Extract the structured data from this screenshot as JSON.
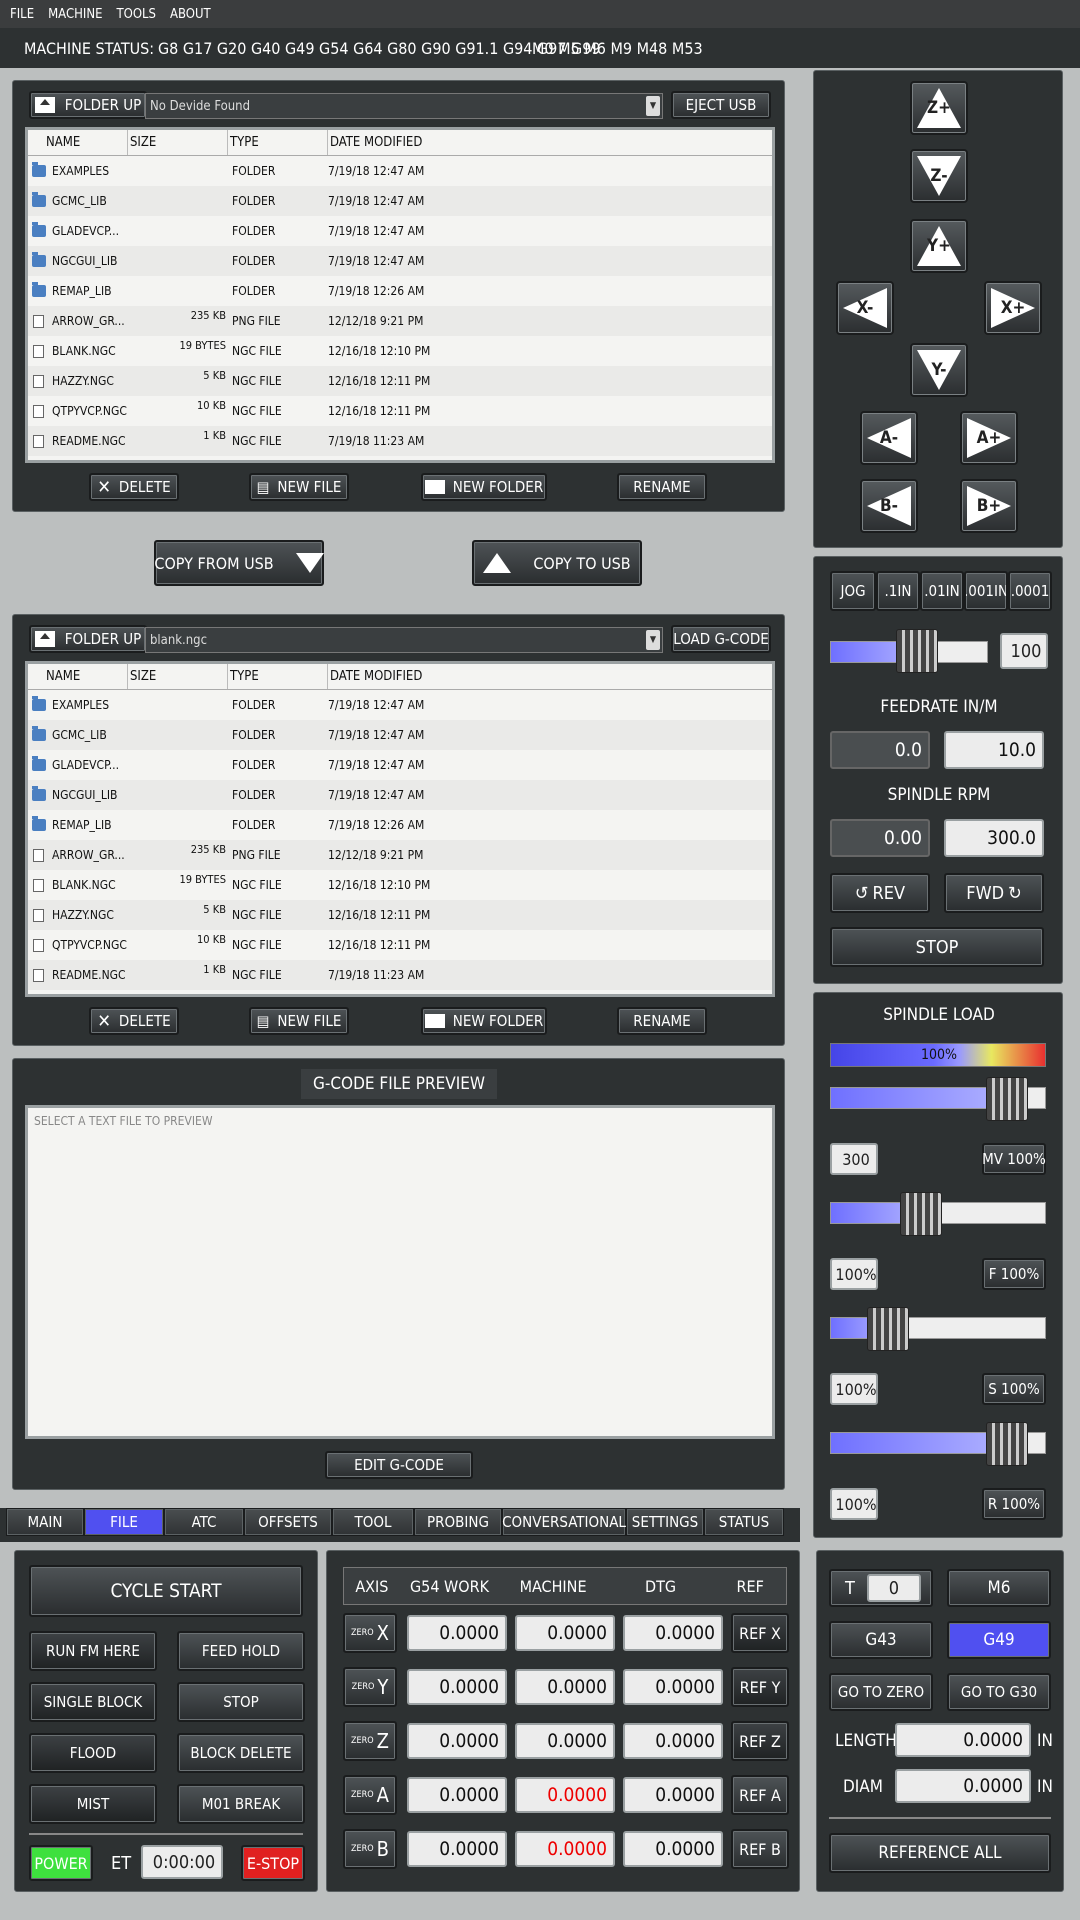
{
  "menu": [
    "FILE",
    "MACHINE",
    "TOOLS",
    "ABOUT"
  ],
  "status": {
    "label": "MACHINE STATUS:",
    "gcodes": "G8 G17 G20 G40 G49 G54 G64 G80 G90 G91.1 G94 G97 G99",
    "mcodes": "M0 M5 M6 M9 M48 M53"
  },
  "usb": {
    "folder_up": "FOLDER UP",
    "device": "No Devide Found",
    "eject": "EJECT USB",
    "cols": [
      "NAME",
      "SIZE",
      "TYPE",
      "DATE MODIFIED"
    ],
    "rows": [
      {
        "name": "EXAMPLES",
        "size": "",
        "type": "FOLDER",
        "date": "7/19/18 12:47 AM",
        "icon": "folder"
      },
      {
        "name": "GCMC_LIB",
        "size": "",
        "type": "FOLDER",
        "date": "7/19/18 12:47 AM",
        "icon": "folder"
      },
      {
        "name": "GLADEVCP...",
        "size": "",
        "type": "FOLDER",
        "date": "7/19/18 12:47 AM",
        "icon": "folder"
      },
      {
        "name": "NGCGUI_LIB",
        "size": "",
        "type": "FOLDER",
        "date": "7/19/18 12:47 AM",
        "icon": "folder"
      },
      {
        "name": "REMAP_LIB",
        "size": "",
        "type": "FOLDER",
        "date": "7/19/18 12:26 AM",
        "icon": "folder"
      },
      {
        "name": "ARROW_GR...",
        "size": "235 KB",
        "type": "PNG FILE",
        "date": "12/12/18 9:21 PM",
        "icon": "doc"
      },
      {
        "name": "BLANK.NGC",
        "size": "19 BYTES",
        "type": "NGC FILE",
        "date": "12/16/18 12:10 PM",
        "icon": "doc"
      },
      {
        "name": "HAZZY.NGC",
        "size": "5 KB",
        "type": "NGC FILE",
        "date": "12/16/18 12:11 PM",
        "icon": "doc"
      },
      {
        "name": "QTPYVCP.NGC",
        "size": "10 KB",
        "type": "NGC FILE",
        "date": "12/16/18 12:11 PM",
        "icon": "doc"
      },
      {
        "name": "README.NGC",
        "size": "1 KB",
        "type": "NGC FILE",
        "date": "7/19/18 11:23 AM",
        "icon": "doc"
      }
    ],
    "delete": "DELETE",
    "new_file": "NEW FILE",
    "new_folder": "NEW FOLDER",
    "rename": "RENAME"
  },
  "copy_from_usb": "COPY FROM USB",
  "copy_to_usb": "COPY TO USB",
  "local": {
    "folder_up": "FOLDER UP",
    "file": "blank.ngc",
    "load": "LOAD G-CODE",
    "cols": [
      "NAME",
      "SIZE",
      "TYPE",
      "DATE MODIFIED"
    ],
    "rows": [
      {
        "name": "EXAMPLES",
        "size": "",
        "type": "FOLDER",
        "date": "7/19/18 12:47 AM",
        "icon": "folder"
      },
      {
        "name": "GCMC_LIB",
        "size": "",
        "type": "FOLDER",
        "date": "7/19/18 12:47 AM",
        "icon": "folder"
      },
      {
        "name": "GLADEVCP...",
        "size": "",
        "type": "FOLDER",
        "date": "7/19/18 12:47 AM",
        "icon": "folder"
      },
      {
        "name": "NGCGUI_LIB",
        "size": "",
        "type": "FOLDER",
        "date": "7/19/18 12:47 AM",
        "icon": "folder"
      },
      {
        "name": "REMAP_LIB",
        "size": "",
        "type": "FOLDER",
        "date": "7/19/18 12:26 AM",
        "icon": "folder"
      },
      {
        "name": "ARROW_GR...",
        "size": "235 KB",
        "type": "PNG FILE",
        "date": "12/12/18 9:21 PM",
        "icon": "doc"
      },
      {
        "name": "BLANK.NGC",
        "size": "19 BYTES",
        "type": "NGC FILE",
        "date": "12/16/18 12:10 PM",
        "icon": "doc"
      },
      {
        "name": "HAZZY.NGC",
        "size": "5 KB",
        "type": "NGC FILE",
        "date": "12/16/18 12:11 PM",
        "icon": "doc"
      },
      {
        "name": "QTPYVCP.NGC",
        "size": "10 KB",
        "type": "NGC FILE",
        "date": "12/16/18 12:11 PM",
        "icon": "doc"
      },
      {
        "name": "README.NGC",
        "size": "1 KB",
        "type": "NGC FILE",
        "date": "7/19/18 11:23 AM",
        "icon": "doc"
      }
    ],
    "delete": "DELETE",
    "new_file": "NEW FILE",
    "new_folder": "NEW FOLDER",
    "rename": "RENAME"
  },
  "preview": {
    "title": "G-CODE FILE PREVIEW",
    "placeholder": "SELECT A TEXT FILE TO PREVIEW",
    "edit": "EDIT G-CODE"
  },
  "jog": {
    "zp": "Z+",
    "zm": "Z-",
    "yp": "Y+",
    "ym": "Y-",
    "xm": "X-",
    "xp": "X+",
    "am": "A-",
    "ap": "A+",
    "bm": "B-",
    "bp": "B+"
  },
  "increments": [
    "JOG",
    ".1IN",
    ".01IN",
    ".001IN",
    ".0001"
  ],
  "jog_speed": {
    "value": "100",
    "level_pct": 55
  },
  "feedrate": {
    "label": "FEEDRATE IN/M",
    "actual": "0.0",
    "set": "10.0"
  },
  "spindle": {
    "label": "SPINDLE RPM",
    "actual": "0.00",
    "set": "300.0",
    "rev": "REV",
    "fwd": "FWD",
    "stop": "STOP"
  },
  "load": {
    "label": "SPINDLE LOAD",
    "bar_value": "100%"
  },
  "overrides": [
    {
      "left": "300",
      "right": "MV 100%",
      "level_pct": 82
    },
    {
      "left": "100%",
      "right": "F 100%",
      "level_pct": 42
    },
    {
      "left": "100%",
      "right": "S 100%",
      "level_pct": 27
    },
    {
      "left": "100%",
      "right": "R 100%",
      "level_pct": 82
    }
  ],
  "tabs": [
    "MAIN",
    "FILE",
    "ATC",
    "OFFSETS",
    "TOOL",
    "PROBING",
    "CONVERSATIONAL",
    "SETTINGS",
    "STATUS"
  ],
  "controls": {
    "cycle_start": "CYCLE START",
    "run_from_here": "RUN FM HERE",
    "feed_hold": "FEED HOLD",
    "single_block": "SINGLE BLOCK",
    "stop": "STOP",
    "flood": "FLOOD",
    "block_delete": "BLOCK DELETE",
    "mist": "MIST",
    "m01_break": "M01 BREAK",
    "power": "POWER",
    "et_label": "ET",
    "et_value": "0:00:00",
    "estop": "E-STOP"
  },
  "dro": {
    "headers": [
      "AXIS",
      "G54 WORK",
      "MACHINE",
      "DTG",
      "REF"
    ],
    "zero": "ZERO",
    "rows": [
      {
        "axis": "X",
        "work": "0.0000",
        "machine": "0.0000",
        "dtg": "0.0000",
        "ref": "REF X",
        "red": false
      },
      {
        "axis": "Y",
        "work": "0.0000",
        "machine": "0.0000",
        "dtg": "0.0000",
        "ref": "REF Y",
        "red": false
      },
      {
        "axis": "Z",
        "work": "0.0000",
        "machine": "0.0000",
        "dtg": "0.0000",
        "ref": "REF Z",
        "red": false
      },
      {
        "axis": "A",
        "work": "0.0000",
        "machine": "0.0000",
        "dtg": "0.0000",
        "ref": "REF A",
        "red": true
      },
      {
        "axis": "B",
        "work": "0.0000",
        "machine": "0.0000",
        "dtg": "0.0000",
        "ref": "REF B",
        "red": true
      }
    ]
  },
  "tool": {
    "t_label": "T",
    "t_value": "0",
    "m6": "M6",
    "g43": "G43",
    "g49": "G49",
    "go_zero": "GO TO ZERO",
    "go_g30": "GO TO G30",
    "length_label": "LENGTH",
    "length": "0.0000",
    "diam_label": "DIAM",
    "diam": "0.0000",
    "unit": "IN",
    "ref_all": "REFERENCE ALL"
  },
  "colors": {
    "accent": "#5050f0",
    "power": "#3ee03e",
    "estop": "#e02020",
    "red_text": "#e00000"
  }
}
